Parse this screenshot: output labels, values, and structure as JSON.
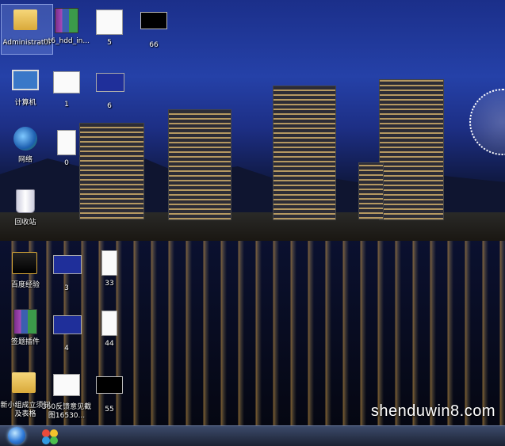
{
  "desktop_icons": [
    {
      "label": "Administrator",
      "type": "folder",
      "selected": true
    },
    {
      "label": "nt6_hdd_in...",
      "type": "winrar"
    },
    {
      "label": "5",
      "type": "image-white"
    },
    {
      "label": "66",
      "type": "image-black"
    },
    {
      "label": "计算机",
      "type": "computer"
    },
    {
      "label": "1",
      "type": "image-white"
    },
    {
      "label": "6",
      "type": "image-blue"
    },
    {
      "label": "网络",
      "type": "network"
    },
    {
      "label": "0",
      "type": "image-white"
    },
    {
      "label": "回收站",
      "type": "recycle-bin"
    },
    {
      "label": "百度经验",
      "type": "folder"
    },
    {
      "label": "3",
      "type": "image-blue"
    },
    {
      "label": "33",
      "type": "image-white"
    },
    {
      "label": "签题插件",
      "type": "winrar"
    },
    {
      "label": "4",
      "type": "image-blue"
    },
    {
      "label": "44",
      "type": "image-white"
    },
    {
      "label": "新小组成立须知及表格",
      "type": "folder"
    },
    {
      "label": "360反馈意见截图16530...",
      "type": "image-white"
    },
    {
      "label": "55",
      "type": "image-black"
    }
  ],
  "watermark": "shenduwin8.com",
  "taskbar": {
    "start_icon": "windows-orb-icon",
    "quicklaunch_icon": "360-browser-icon"
  }
}
